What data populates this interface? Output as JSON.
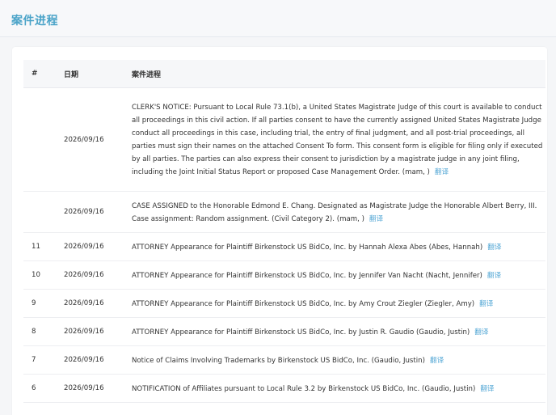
{
  "section": {
    "title": "案件进程"
  },
  "table": {
    "headers": {
      "number": "#",
      "date": "日期",
      "proceedings": "案件进程"
    },
    "translate_label": "翻译",
    "rows": [
      {
        "number": "",
        "date": "2026/09/16",
        "text": "CLERK'S NOTICE: Pursuant to Local Rule 73.1(b), a United States Magistrate Judge of this court is available to conduct all proceedings in this civil action. If all parties consent to have the currently assigned United States Magistrate Judge conduct all proceedings in this case, including trial, the entry of final judgment, and all post-trial proceedings, all parties must sign their names on the attached Consent To form. This consent form is eligible for filing only if executed by all parties. The parties can also express their consent to jurisdiction by a magistrate judge in any joint filing, including the Joint Initial Status Report or proposed Case Management Order. (mam, )"
      },
      {
        "number": "",
        "date": "2026/09/16",
        "text": "CASE ASSIGNED to the Honorable Edmond E. Chang. Designated as Magistrate Judge the Honorable Albert Berry, III. Case assignment: Random assignment. (Civil Category 2). (mam, )"
      },
      {
        "number": "11",
        "date": "2026/09/16",
        "text": "ATTORNEY Appearance for Plaintiff Birkenstock US BidCo, Inc. by Hannah Alexa Abes (Abes, Hannah)"
      },
      {
        "number": "10",
        "date": "2026/09/16",
        "text": "ATTORNEY Appearance for Plaintiff Birkenstock US BidCo, Inc. by Jennifer Van Nacht (Nacht, Jennifer)"
      },
      {
        "number": "9",
        "date": "2026/09/16",
        "text": "ATTORNEY Appearance for Plaintiff Birkenstock US BidCo, Inc. by Amy Crout Ziegler (Ziegler, Amy)"
      },
      {
        "number": "8",
        "date": "2026/09/16",
        "text": "ATTORNEY Appearance for Plaintiff Birkenstock US BidCo, Inc. by Justin R. Gaudio (Gaudio, Justin)"
      },
      {
        "number": "7",
        "date": "2026/09/16",
        "text": "Notice of Claims Involving Trademarks by Birkenstock US BidCo, Inc. (Gaudio, Justin)"
      },
      {
        "number": "6",
        "date": "2026/09/16",
        "text": "NOTIFICATION of Affiliates pursuant to Local Rule 3.2 by Birkenstock US BidCo, Inc. (Gaudio, Justin)"
      }
    ]
  },
  "colors": {
    "title": "#4aa3c8",
    "link": "#57a9d6",
    "text": "#333333",
    "header_bg": "#f6f7f9",
    "page_bg": "#f5f6f8"
  }
}
